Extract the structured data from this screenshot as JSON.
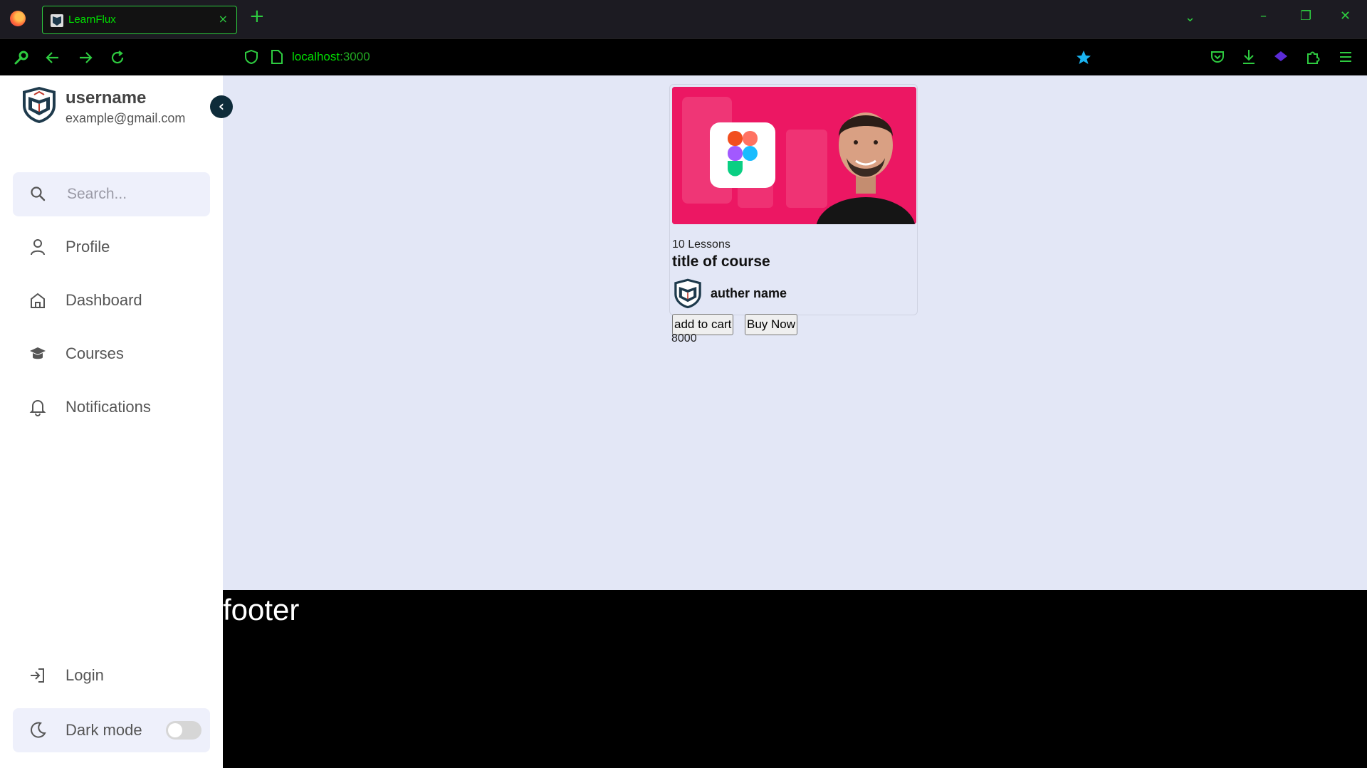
{
  "browser": {
    "tab_title": "LearnFlux",
    "tab_close": "×",
    "new_tab": "+",
    "url_host": "localhost",
    "url_port": ":3000",
    "accent_color": "#2ecc40",
    "bookmark_color": "#1ab3f0"
  },
  "sidebar": {
    "username": "username",
    "email": "example@gmail.com",
    "collapse_symbol": "‹",
    "search_placeholder": "Search...",
    "menu": [
      {
        "label": "Profile",
        "icon": "user-icon"
      },
      {
        "label": "Dashboard",
        "icon": "home-icon"
      },
      {
        "label": "Courses",
        "icon": "graduation-cap-icon"
      },
      {
        "label": "Notifications",
        "icon": "bell-icon"
      }
    ],
    "login_label": "Login",
    "dark_mode_label": "Dark mode",
    "dark_mode_on": false
  },
  "course": {
    "lessons": "10 Lessons",
    "title": "title of course",
    "author": "auther name",
    "add_to_cart": "add to cart",
    "buy_now": "Buy Now",
    "price": "8000"
  },
  "footer": {
    "text": "footer"
  }
}
